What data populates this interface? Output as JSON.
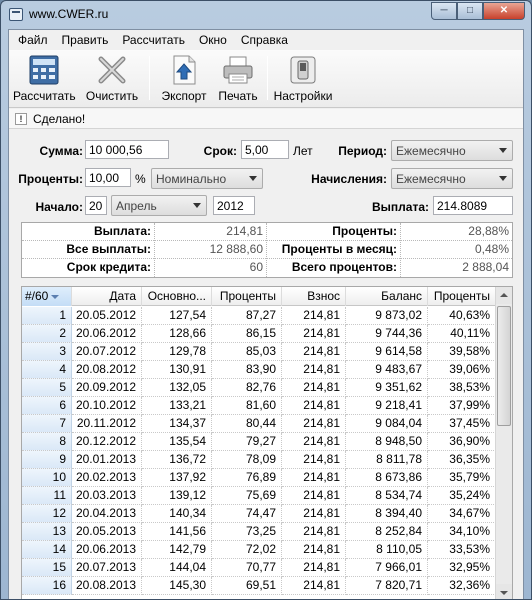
{
  "window": {
    "title": "www.CWER.ru"
  },
  "menu": [
    "Файл",
    "Править",
    "Рассчитать",
    "Окно",
    "Справка"
  ],
  "toolbar": {
    "calculate": "Рассчитать",
    "clear": "Очистить",
    "export": "Экспорт",
    "print": "Печать",
    "settings": "Настройки"
  },
  "status": {
    "text": "Сделано!"
  },
  "form": {
    "sum_label": "Сумма:",
    "sum_value": "10 000,56",
    "term_label": "Срок:",
    "term_value": "5,00",
    "term_unit": "Лет",
    "period_label": "Период:",
    "period_value": "Ежемесячно",
    "rate_label": "Проценты:",
    "rate_value": "10,00",
    "rate_unit": "%",
    "rate_type": "Номинально",
    "accrual_label": "Начисления:",
    "accrual_value": "Ежемесячно",
    "start_label": "Начало:",
    "start_day": "20",
    "start_month": "Апрель",
    "start_year": "2012",
    "payment_label": "Выплата:",
    "payment_value": "214.8089"
  },
  "summary": {
    "rows": [
      {
        "k1": "Выплата:",
        "v1": "214,81",
        "k2": "Проценты:",
        "v2": "28,88%"
      },
      {
        "k1": "Все выплаты:",
        "v1": "12 888,60",
        "k2": "Проценты в месяц:",
        "v2": "0,48%"
      },
      {
        "k1": "Срок кредита:",
        "v1": "60",
        "k2": "Всего процентов:",
        "v2": "2 888,04"
      }
    ]
  },
  "table": {
    "headers": [
      "#/60",
      "Дата",
      "Основно...",
      "Проценты",
      "Взнос",
      "Баланс",
      "Проценты"
    ],
    "rows": [
      [
        "1",
        "20.05.2012",
        "127,54",
        "87,27",
        "214,81",
        "9 873,02",
        "40,63%"
      ],
      [
        "2",
        "20.06.2012",
        "128,66",
        "86,15",
        "214,81",
        "9 744,36",
        "40,11%"
      ],
      [
        "3",
        "20.07.2012",
        "129,78",
        "85,03",
        "214,81",
        "9 614,58",
        "39,58%"
      ],
      [
        "4",
        "20.08.2012",
        "130,91",
        "83,90",
        "214,81",
        "9 483,67",
        "39,06%"
      ],
      [
        "5",
        "20.09.2012",
        "132,05",
        "82,76",
        "214,81",
        "9 351,62",
        "38,53%"
      ],
      [
        "6",
        "20.10.2012",
        "133,21",
        "81,60",
        "214,81",
        "9 218,41",
        "37,99%"
      ],
      [
        "7",
        "20.11.2012",
        "134,37",
        "80,44",
        "214,81",
        "9 084,04",
        "37,45%"
      ],
      [
        "8",
        "20.12.2012",
        "135,54",
        "79,27",
        "214,81",
        "8 948,50",
        "36,90%"
      ],
      [
        "9",
        "20.01.2013",
        "136,72",
        "78,09",
        "214,81",
        "8 811,78",
        "36,35%"
      ],
      [
        "10",
        "20.02.2013",
        "137,92",
        "76,89",
        "214,81",
        "8 673,86",
        "35,79%"
      ],
      [
        "11",
        "20.03.2013",
        "139,12",
        "75,69",
        "214,81",
        "8 534,74",
        "35,24%"
      ],
      [
        "12",
        "20.04.2013",
        "140,34",
        "74,47",
        "214,81",
        "8 394,40",
        "34,67%"
      ],
      [
        "13",
        "20.05.2013",
        "141,56",
        "73,25",
        "214,81",
        "8 252,84",
        "34,10%"
      ],
      [
        "14",
        "20.06.2013",
        "142,79",
        "72,02",
        "214,81",
        "8 110,05",
        "33,53%"
      ],
      [
        "15",
        "20.07.2013",
        "144,04",
        "70,77",
        "214,81",
        "7 966,01",
        "32,95%"
      ],
      [
        "16",
        "20.08.2013",
        "145,30",
        "69,51",
        "214,81",
        "7 820,71",
        "32,36%"
      ]
    ]
  }
}
